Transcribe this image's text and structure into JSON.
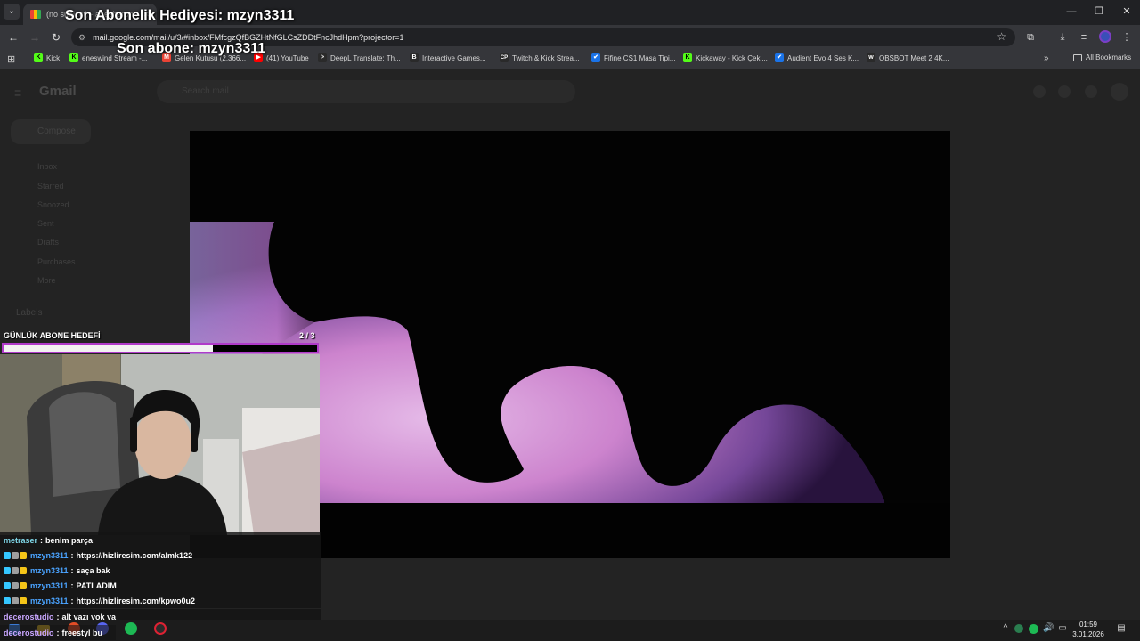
{
  "browser": {
    "tab": {
      "title": "(no subject) - anesharon..."
    },
    "url": "mail.google.com/mail/u/3/#inbox/FMfcgzQfBGZHtNfGLCsZDDtFncJhdHpm?projector=1",
    "bookmarks": [
      {
        "label": "Kick",
        "color": "#53fc18",
        "glyph": "K"
      },
      {
        "label": "eneswind Stream -...",
        "color": "#53fc18",
        "glyph": "K"
      },
      {
        "label": "Gelen Kutusu (2.366...",
        "color": "#ea4335",
        "glyph": "M"
      },
      {
        "label": "(41) YouTube",
        "color": "#ff0000",
        "glyph": "▶"
      },
      {
        "label": "DeepL Translate: Th...",
        "color": "#2a2a2a",
        "glyph": ">"
      },
      {
        "label": "Interactive Games...",
        "color": "#2a2a2a",
        "glyph": "B"
      },
      {
        "label": "Twitch & Kick Strea...",
        "color": "#2a2a2a",
        "glyph": "CP"
      },
      {
        "label": "Fifine CS1 Masa Tipi...",
        "color": "#1a73e8",
        "glyph": "✔"
      },
      {
        "label": "Kickaway - Kick Çeki...",
        "color": "#53fc18",
        "glyph": "K"
      },
      {
        "label": "Audient Evo 4 Ses K...",
        "color": "#1a73e8",
        "glyph": "✔"
      },
      {
        "label": "OBSBOT Meet 2 4K...",
        "color": "#2a2a2a",
        "glyph": "w"
      }
    ],
    "all_bookmarks": "All Bookmarks"
  },
  "gmail": {
    "logo": "Gmail",
    "search_placeholder": "Search mail",
    "compose": "Compose",
    "nav": [
      "Inbox",
      "Starred",
      "Snoozed",
      "Sent",
      "Drafts",
      "Purchases",
      "More"
    ],
    "labels": "Labels"
  },
  "stream_overlay": {
    "gift_sub": "Son Abonelik Hediyesi: mzyn3311",
    "last_sub": "Son abone: mzyn3311",
    "goal": {
      "label": "GÜNLÜK ABONE HEDEFİ",
      "current": 2,
      "target": 3,
      "count_text": "2  / 3",
      "progress": 0.667
    }
  },
  "chat": [
    {
      "user": "metraser",
      "color": "#7fd7e8",
      "badges": [],
      "message": "benim parça"
    },
    {
      "user": "mzyn3311",
      "color": "#4aa3ff",
      "badges": [
        "#35c7ff",
        "#9e9e9e",
        "#f5c518"
      ],
      "message": "https://hizliresim.com/almk122"
    },
    {
      "user": "mzyn3311",
      "color": "#4aa3ff",
      "badges": [
        "#35c7ff",
        "#9e9e9e",
        "#f5c518"
      ],
      "message": "saça bak"
    },
    {
      "user": "mzyn3311",
      "color": "#4aa3ff",
      "badges": [
        "#35c7ff",
        "#9e9e9e",
        "#f5c518"
      ],
      "message": "PATLADIM"
    },
    {
      "user": "mzyn3311",
      "color": "#4aa3ff",
      "badges": [
        "#35c7ff",
        "#9e9e9e",
        "#f5c518"
      ],
      "message": "https://hizliresim.com/kpwo0u2"
    },
    {
      "user": "decerostudio",
      "color": "#c9a6ff",
      "badges": [],
      "message": "alt yazı yok ya"
    },
    {
      "user": "decerostudio",
      "color": "#c9a6ff",
      "badges": [],
      "message": "freestyl bu"
    }
  ],
  "taskbar": {
    "time": "01:59",
    "date": "3.01.2026"
  }
}
